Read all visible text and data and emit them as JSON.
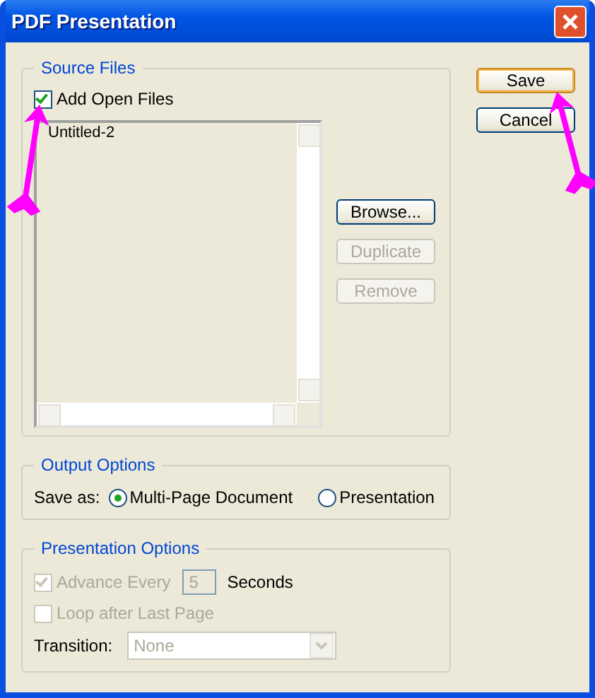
{
  "window": {
    "title": "PDF Presentation"
  },
  "source_files": {
    "title": "Source Files",
    "add_open_files": {
      "label": "Add Open Files",
      "checked": true
    },
    "files": [
      {
        "name": "Untitled-2",
        "selected": false
      }
    ],
    "buttons": [
      {
        "label": "Browse...",
        "disabled": false
      },
      {
        "label": "Duplicate",
        "disabled": true
      },
      {
        "label": "Remove",
        "disabled": true
      }
    ]
  },
  "dialog_buttons": [
    {
      "label": "Save",
      "default": true
    },
    {
      "label": "Cancel",
      "default": false
    }
  ],
  "output_options": {
    "title": "Output Options",
    "save_as_label": "Save as:",
    "options": [
      {
        "label": "Multi-Page Document",
        "selected": true
      },
      {
        "label": "Presentation",
        "selected": false
      }
    ]
  },
  "presentation_options": {
    "title": "Presentation Options",
    "advance": {
      "label": "Advance Every",
      "checked": true,
      "disabled": true
    },
    "interval": {
      "value": "5",
      "disabled": true
    },
    "unit": "Seconds",
    "loop": {
      "label": "Loop after Last Page",
      "checked": false,
      "disabled": true
    },
    "transition": {
      "label": "Transition:",
      "value": "None",
      "disabled": true
    }
  },
  "annotations": [
    {
      "kind": "arrow"
    },
    {
      "kind": "arrow"
    }
  ]
}
